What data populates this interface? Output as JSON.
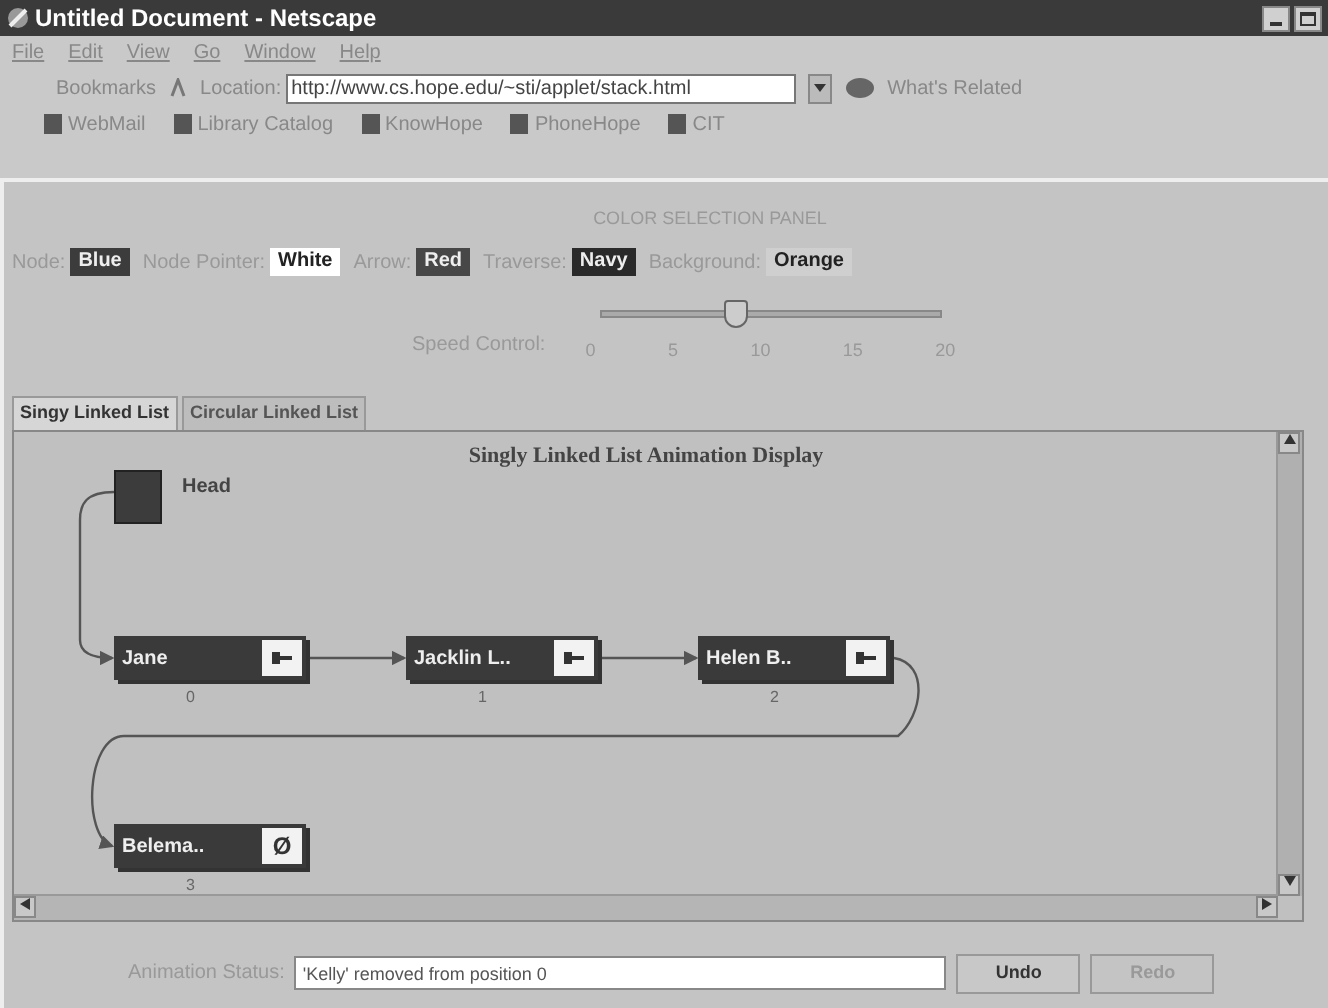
{
  "window": {
    "title": "Untitled Document - Netscape"
  },
  "menu": [
    "File",
    "Edit",
    "View",
    "Go",
    "Window",
    "Help"
  ],
  "location_bar": {
    "bookmarks": "Bookmarks",
    "label": "Location:",
    "value": "http://www.cs.hope.edu/~sti/applet/stack.html",
    "related": "What's Related"
  },
  "personal_toolbar": [
    "WebMail",
    "Library Catalog",
    "KnowHope",
    "PhoneHope",
    "CIT"
  ],
  "color_panel": {
    "title": "COLOR SELECTION PANEL",
    "swatches": [
      {
        "label": "Node:",
        "value": "Blue",
        "color": "#3c3c3c"
      },
      {
        "label": "Node Pointer:",
        "value": "White",
        "color": "#ffffff"
      },
      {
        "label": "Arrow:",
        "value": "Red",
        "color": "#474747"
      },
      {
        "label": "Traverse:",
        "value": "Navy",
        "color": "#2a2a2a"
      },
      {
        "label": "Background:",
        "value": "Orange",
        "color": "#cfcfcf"
      }
    ]
  },
  "speed": {
    "label": "Speed Control:",
    "level": 0.4,
    "ticks": [
      "0",
      "5",
      "10",
      "15",
      "20"
    ]
  },
  "tabs": [
    {
      "label": "Singy Linked List",
      "selected": true
    },
    {
      "label": "Circular Linked List",
      "selected": false
    }
  ],
  "display": {
    "title": "Singly Linked List Animation Display",
    "head": "Head",
    "nodes": [
      {
        "name": "Jane",
        "index": "0",
        "kind": "link"
      },
      {
        "name": "Jacklin L..",
        "index": "1",
        "kind": "link"
      },
      {
        "name": "Helen B..",
        "index": "2",
        "kind": "link"
      },
      {
        "name": "Belema..",
        "index": "3",
        "kind": "null",
        "pointer": "Ø"
      }
    ]
  },
  "status": {
    "label": "Animation Status:",
    "value": "'Kelly' removed from position 0"
  },
  "buttons": [
    {
      "label": "Undo",
      "disabled": false
    },
    {
      "label": "Redo",
      "disabled": true
    }
  ]
}
